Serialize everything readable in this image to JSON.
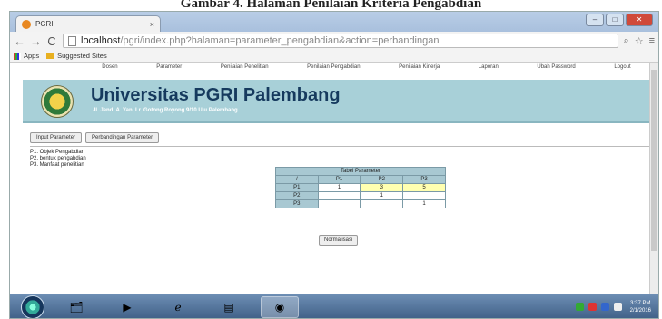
{
  "caption": "Gambar 4. Halaman Penilaian Kriteria Pengabdian",
  "browser": {
    "tab_title": "PGRI",
    "tab_close": "×",
    "url_host": "localhost",
    "url_path": "/pgri/index.php?halaman=parameter_pengabdian&action=perbandingan",
    "bookmarks": [
      "Apps",
      "Suggested Sites"
    ]
  },
  "nav": [
    "Dosen",
    "Parameter",
    "Penilaian Penelitian",
    "Penilaian Pengabdian",
    "Penilaian Kinerja",
    "Laporan",
    "Ubah Password",
    "Logout"
  ],
  "banner": {
    "title": "Universitas PGRI Palembang",
    "address": "Jl. Jend. A. Yani Lr. Gotong Royong 9/10 Ulu Palembang"
  },
  "buttons": {
    "input": "Input Parameter",
    "compare": "Perbandingan Parameter",
    "normalize": "Normalisasi"
  },
  "params": [
    "P1. Objek Pengabdian",
    "P2. bentuk pengabdian",
    "P3. Manfaat penelitian"
  ],
  "table": {
    "title": "Tabel Parameter",
    "corner": "/",
    "cols": [
      "P1",
      "P2",
      "P3"
    ],
    "rows": [
      {
        "label": "P1",
        "cells": [
          "1",
          "3",
          "5"
        ]
      },
      {
        "label": "P2",
        "cells": [
          "",
          "1",
          ""
        ]
      },
      {
        "label": "P3",
        "cells": [
          "",
          "",
          "1"
        ]
      }
    ]
  },
  "taskbar": {
    "time": "3:37 PM",
    "date": "2/1/2016"
  },
  "colors": {
    "banner": "#a8d0d8",
    "title": "#163a5e",
    "table_header": "#a8c8d2",
    "input_highlight": "#ffffb0"
  }
}
